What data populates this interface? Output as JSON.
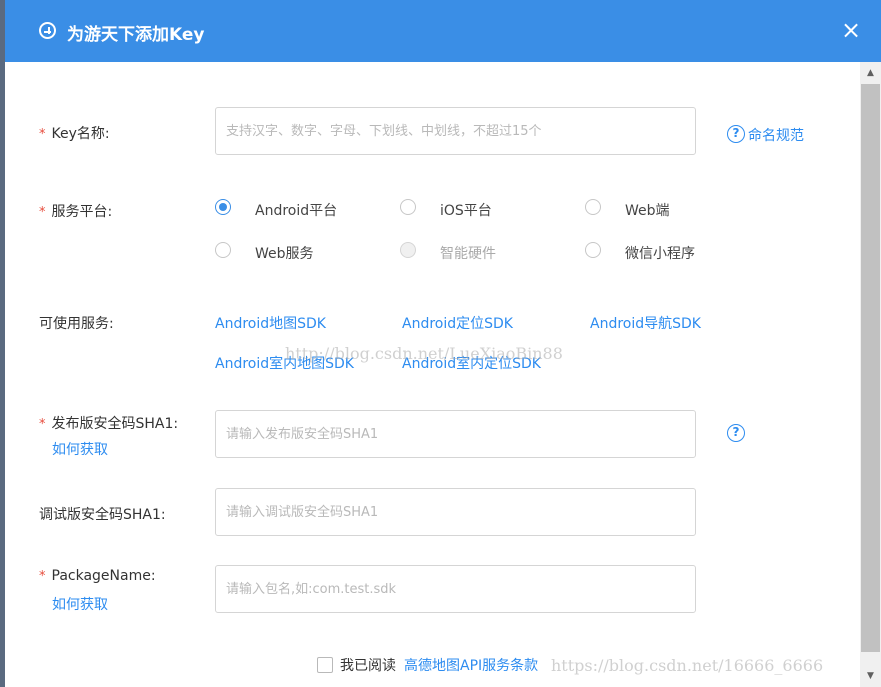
{
  "dialog": {
    "title": "为游天下添加Key",
    "close_icon": "×"
  },
  "form": {
    "key_name": {
      "label": "Key名称:",
      "placeholder": "支持汉字、数字、字母、下划线、中划线，不超过15个",
      "help_link": "命名规范"
    },
    "platform": {
      "label": "服务平台:",
      "options": [
        {
          "label": "Android平台",
          "checked": true
        },
        {
          "label": "iOS平台"
        },
        {
          "label": "Web端"
        },
        {
          "label": "Web服务"
        },
        {
          "label": "智能硬件",
          "disabled": true
        },
        {
          "label": "微信小程序"
        }
      ]
    },
    "services": {
      "label": "可使用服务:",
      "items": [
        "Android地图SDK",
        "Android定位SDK",
        "Android导航SDK",
        "Android室内地图SDK",
        "Android室内定位SDK"
      ]
    },
    "release_sha1": {
      "label": "发布版安全码SHA1:",
      "how_link": "如何获取",
      "placeholder": "请输入发布版安全码SHA1"
    },
    "debug_sha1": {
      "label": "调试版安全码SHA1:",
      "placeholder": "请输入调试版安全码SHA1"
    },
    "package_name": {
      "label": "PackageName:",
      "how_link": "如何获取",
      "placeholder": "请输入包名,如:com.test.sdk"
    },
    "agreement": {
      "prefix": "我已阅读",
      "link": "高德地图API服务条款"
    }
  },
  "watermarks": {
    "middle": "http://blog.csdn.net/LueXiaoBin88",
    "bottom": "https://blog.csdn.net/16666_6666"
  },
  "colors": {
    "header": "#3a8ee6",
    "link": "#2d8cf0",
    "required_star": "#e74c3c"
  }
}
